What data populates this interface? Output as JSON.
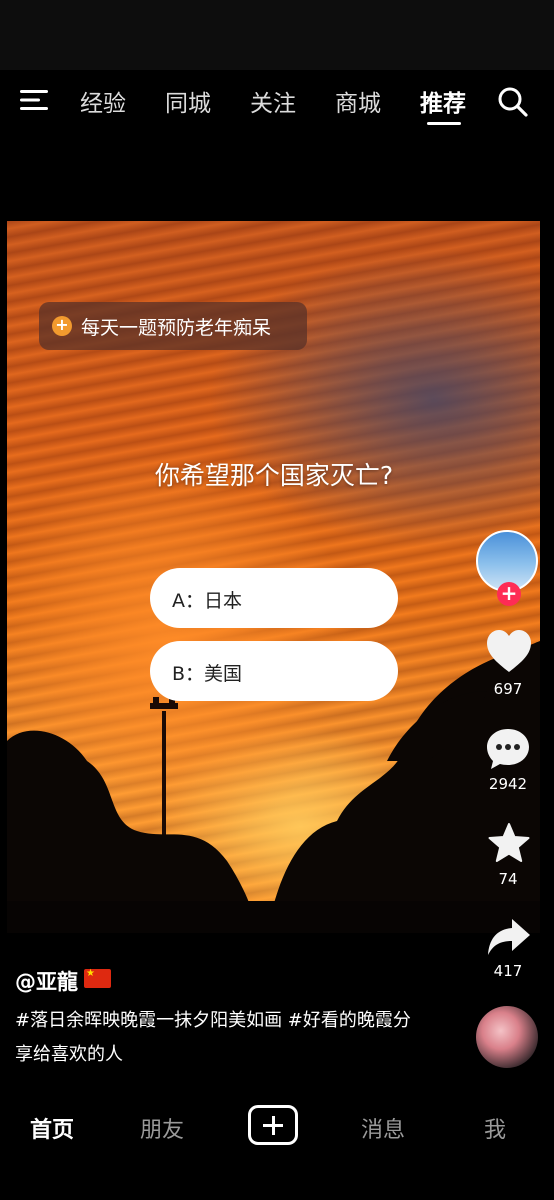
{
  "topnav": {
    "tabs": [
      {
        "label": "经验"
      },
      {
        "label": "同城"
      },
      {
        "label": "关注"
      },
      {
        "label": "商城"
      },
      {
        "label": "推荐",
        "active": true
      }
    ]
  },
  "video": {
    "promo": "每天一题预防老年痴呆",
    "question": "你希望那个国家灭亡?",
    "options": [
      {
        "label": "A：日本"
      },
      {
        "label": "B：美国"
      }
    ]
  },
  "sidebar": {
    "likes": "697",
    "comments": "2942",
    "favorites": "74",
    "shares": "417"
  },
  "post": {
    "author": "@亚龍",
    "caption": "#落日余晖映晚霞一抹夕阳美如画 #好看的晚霞分享给喜欢的人"
  },
  "bottom_nav": {
    "home": "首页",
    "friends": "朋友",
    "messages": "消息",
    "me": "我"
  },
  "colors": {
    "background": "#000000",
    "follow_badge": "#fe2c55",
    "promo_icon": "#f29a2e"
  }
}
